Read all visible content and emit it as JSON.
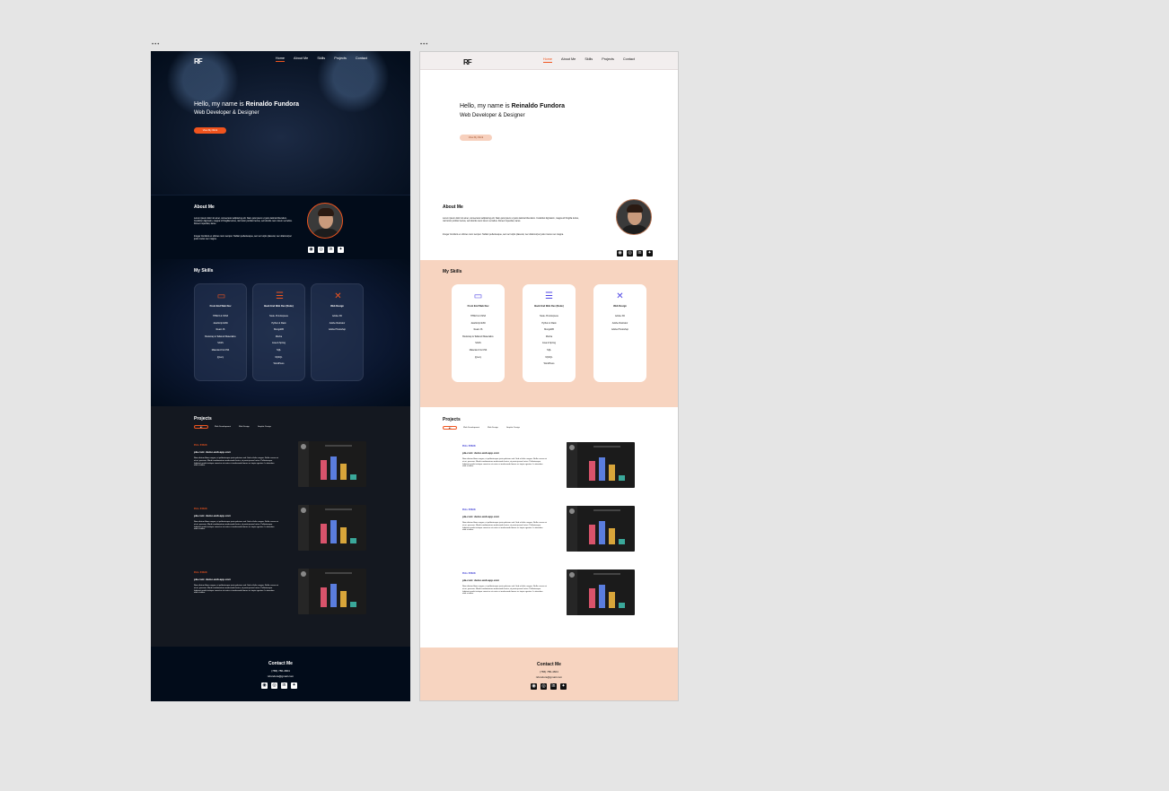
{
  "frames": [
    {
      "id": "dark",
      "label": "•••"
    },
    {
      "id": "light",
      "label": "•••"
    }
  ],
  "nav": {
    "logo": "RF",
    "links": [
      "Home",
      "About Me",
      "Skills",
      "Projects",
      "Contact"
    ]
  },
  "hero": {
    "greeting": "Hello, my name is ",
    "name": "Reinaldo Fundora",
    "role": "Web Developer & Designer",
    "button": "View My Work"
  },
  "about": {
    "title": "About Me",
    "paragraph1": "Lorem ipsum dolor sit amet, consectetur adipiscing elit. Nam quis ipsum ut justo lacinia bibendum. Curabitur dignissim, magna id fringilla luctus, nisl tortor porttitor lectus, vel lobortis nunc lorem vel tellus. Donec imperdiet, lacus.",
    "paragraph2": "Integer tincidunt ex ultrices nunc semper. Nullam pellentesque, sem ac turpis placerat, nec ullamcorper justo metus nec magna.",
    "socials": [
      {
        "icon": "github-icon",
        "glyph": "◉"
      },
      {
        "icon": "instagram-icon",
        "glyph": "◎"
      },
      {
        "icon": "linkedin-icon",
        "glyph": "in"
      },
      {
        "icon": "twitter-icon",
        "glyph": "✦"
      }
    ]
  },
  "skills": {
    "title": "My Skills",
    "cards": [
      {
        "icon": "code-icon",
        "glyph": "▭",
        "title": "Front End Web Dev",
        "items": [
          "HTML5 & CSS3",
          "JavaScript ES6",
          "React JS",
          "Bootstrap & Tailwind/ Materialize",
          "SASS",
          "Material-UI & CSS",
          "jQuery"
        ]
      },
      {
        "icon": "server-icon",
        "glyph": "☰",
        "title": "Back End Web Dev (Node)",
        "items": [
          "Node JS & Express",
          "Python & Flask",
          "MongoDB",
          "Mocha",
          "Java & Spring",
          "SQL",
          "MySQL",
          "WordPress"
        ]
      },
      {
        "icon": "design-icon",
        "glyph": "✕",
        "title": "Web Design",
        "items": [
          "Adobe XD",
          "Adobe Illustrator",
          "Adobe Photoshop"
        ]
      }
    ]
  },
  "projects": {
    "title": "Projects",
    "filters": [
      "All",
      "Web Development",
      "Web Design",
      "Graphic Design"
    ],
    "items": [
      {
        "tag": "FULL STACK",
        "title": "pla.com: demo.web.app.com",
        "desc": "Nam dictum libero augue, et pellentesque justo pulvinar sed. Sed at felis congue. Nulla cursus mi at mi, posuere. Morbi condimentum malesuada lectus, at porta ipsum luctus. Pellentesque habitant morbi tristique senectus et netus et malesuada fames ac turpis egestas. In interdum nibh et dolor."
      },
      {
        "tag": "FULL STACK",
        "title": "pla.com: demo.web.app.com",
        "desc": "Nam dictum libero augue, et pellentesque justo pulvinar sed. Sed at felis congue. Nulla cursus mi at mi, posuere. Morbi condimentum malesuada lectus, at porta ipsum luctus. Pellentesque habitant morbi tristique senectus et netus et malesuada fames ac turpis egestas. In interdum nibh et dolor."
      },
      {
        "tag": "FULL STACK",
        "title": "pla.com: demo.web.app.com",
        "desc": "Nam dictum libero augue, et pellentesque justo pulvinar sed. Sed at felis congue. Nulla cursus mi at mi, posuere. Morbi condimentum malesuada lectus, at porta ipsum luctus. Pellentesque habitant morbi tristique senectus et netus et malesuada fames ac turpis egestas. In interdum nibh et dolor."
      }
    ]
  },
  "contact": {
    "title": "Contact Me",
    "phone": "(786) 786-4664",
    "email": "rsfundora@gmail.com"
  },
  "colors": {
    "accent": "#f0541e",
    "dark_bg": "#020c1a",
    "light_peach": "#f7d4c0",
    "bar_colors": [
      "#d9536b",
      "#5a7dde",
      "#d8a53a",
      "#3aa89a"
    ]
  }
}
